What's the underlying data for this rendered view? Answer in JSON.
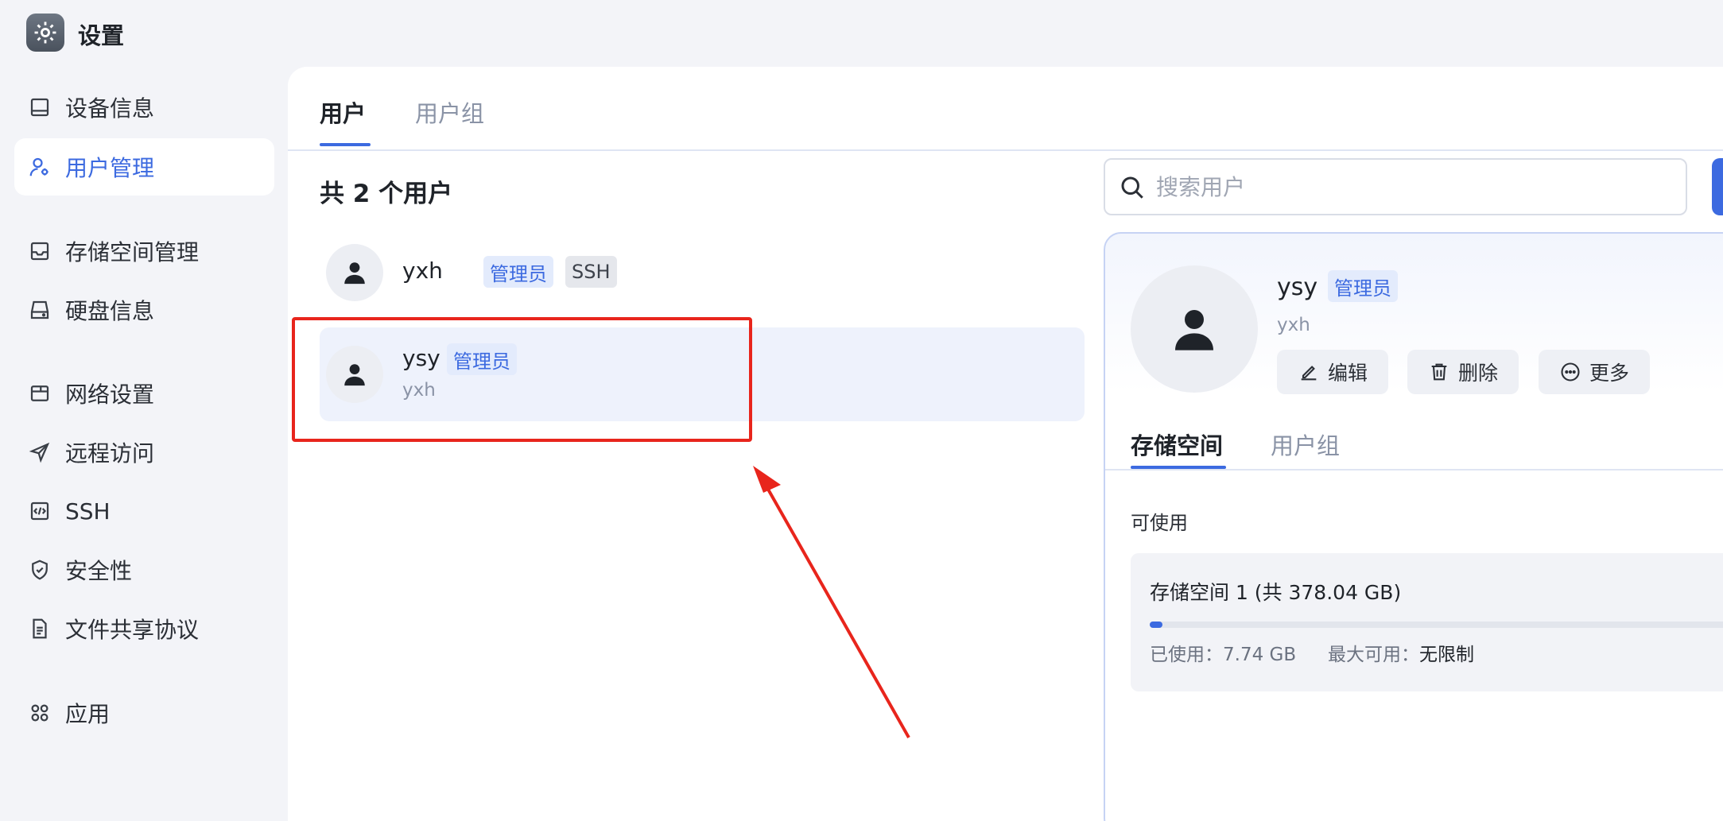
{
  "app": {
    "title": "设置"
  },
  "sidebar": {
    "items": [
      {
        "label": "设备信息",
        "icon": "monitor-icon"
      },
      {
        "label": "用户管理",
        "icon": "user-gear-icon",
        "active": true
      },
      {
        "label": "存储空间管理",
        "icon": "inbox-icon"
      },
      {
        "label": "硬盘信息",
        "icon": "hard-drive-icon"
      },
      {
        "label": "网络设置",
        "icon": "browser-window-icon"
      },
      {
        "label": "远程访问",
        "icon": "send-icon"
      },
      {
        "label": "SSH",
        "icon": "code-box-icon"
      },
      {
        "label": "安全性",
        "icon": "shield-check-icon"
      },
      {
        "label": "文件共享协议",
        "icon": "document-icon"
      },
      {
        "label": "应用",
        "icon": "apps-grid-icon"
      }
    ]
  },
  "main": {
    "tabs": [
      {
        "label": "用户",
        "active": true
      },
      {
        "label": "用户组",
        "active": false
      }
    ],
    "user_count": "共 2 个用户",
    "users": [
      {
        "name": "yxh",
        "badges": [
          "管理员",
          "SSH"
        ],
        "sub": ""
      },
      {
        "name": "ysy",
        "badges": [
          "管理员"
        ],
        "sub": "yxh",
        "selected": true
      }
    ]
  },
  "search": {
    "placeholder": "搜索用户"
  },
  "detail": {
    "name": "ysy",
    "badge": "管理员",
    "sub": "yxh",
    "actions": {
      "edit": "编辑",
      "delete": "删除",
      "more": "更多"
    },
    "tabs": [
      {
        "label": "存储空间",
        "active": true
      },
      {
        "label": "用户组",
        "active": false
      }
    ],
    "available_label": "可使用",
    "storage": {
      "title": "存储空间 1 (共 378.04 GB)",
      "used_label": "已使用：",
      "used_value": "7.74 GB",
      "max_label": "最大可用：",
      "max_value": "无限制",
      "used_fraction": 0.0205
    }
  },
  "colors": {
    "accent": "#3c6ae0",
    "annotation": "#e8251c"
  }
}
